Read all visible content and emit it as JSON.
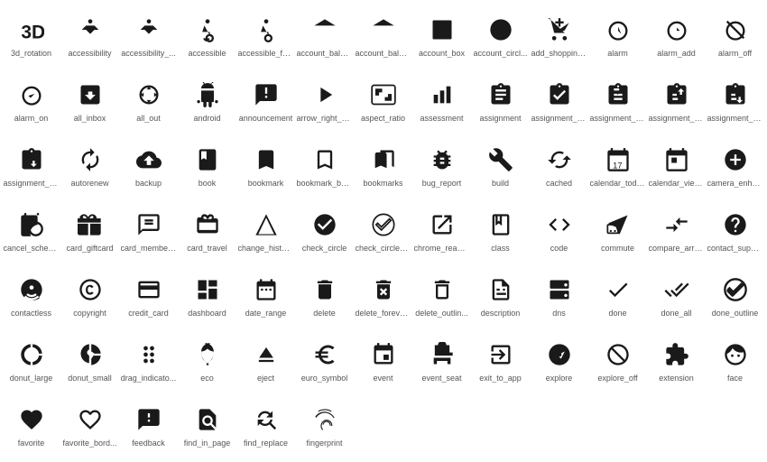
{
  "icons": [
    {
      "symbol": "3d_rotation",
      "label": "3d_rotation",
      "unicode": "⟳",
      "svg": "3d"
    },
    {
      "symbol": "accessibility",
      "label": "accessibility",
      "unicode": "♿",
      "svg": "person_arms"
    },
    {
      "symbol": "accessibility_",
      "label": "accessibility_...",
      "unicode": "♿",
      "svg": "person_arms2"
    },
    {
      "symbol": "accessible",
      "label": "accessible",
      "unicode": "♿",
      "svg": "wheelchair"
    },
    {
      "symbol": "accessible_fo",
      "label": "accessible_fo...",
      "unicode": "♿",
      "svg": "wheelchair2"
    },
    {
      "symbol": "account_balan",
      "label": "account_balan...",
      "unicode": "🏛",
      "svg": "bank"
    },
    {
      "symbol": "account_balan_",
      "label": "account_balan...",
      "unicode": "🏛",
      "svg": "bank2"
    },
    {
      "symbol": "account_box",
      "label": "account_box",
      "unicode": "👤",
      "svg": "account_box"
    },
    {
      "symbol": "account_circl",
      "label": "account_circl...",
      "unicode": "👤",
      "svg": "account_circle"
    },
    {
      "symbol": "add_shopping",
      "label": "add_shopping_...",
      "unicode": "🛒",
      "svg": "cart_add"
    },
    {
      "symbol": "alarm",
      "label": "alarm",
      "unicode": "⏰",
      "svg": "alarm"
    },
    {
      "symbol": "alarm_add",
      "label": "alarm_add",
      "unicode": "⏰",
      "svg": "alarm_add"
    },
    {
      "symbol": "alarm_off",
      "label": "alarm_off",
      "unicode": "⏰",
      "svg": "alarm_off"
    },
    {
      "symbol": "alarm_on",
      "label": "alarm_on",
      "unicode": "⏰",
      "svg": "alarm_on"
    },
    {
      "symbol": "all_inbox",
      "label": "all_inbox",
      "unicode": "📥",
      "svg": "all_inbox"
    },
    {
      "symbol": "all_out",
      "label": "all_out",
      "unicode": "◎",
      "svg": "all_out"
    },
    {
      "symbol": "android",
      "label": "android",
      "unicode": "🤖",
      "svg": "android"
    },
    {
      "symbol": "announcement",
      "label": "announcement",
      "unicode": "📢",
      "svg": "announcement"
    },
    {
      "symbol": "arrow_right_a",
      "label": "arrow_right_a...",
      "unicode": "→",
      "svg": "arrow_right"
    },
    {
      "symbol": "aspect_ratio",
      "label": "aspect_ratio",
      "unicode": "⬜",
      "svg": "aspect_ratio"
    },
    {
      "symbol": "assessment",
      "label": "assessment",
      "unicode": "📊",
      "svg": "bar_chart"
    },
    {
      "symbol": "assignment",
      "label": "assignment",
      "unicode": "📋",
      "svg": "assignment"
    },
    {
      "symbol": "assignment_in",
      "label": "assignment_in...",
      "unicode": "📋",
      "svg": "assignment_in"
    },
    {
      "symbol": "assignment_la",
      "label": "assignment_la...",
      "unicode": "📋",
      "svg": "assignment_la"
    },
    {
      "symbol": "assignment_re",
      "label": "assignment_re...",
      "unicode": "📋",
      "svg": "assignment_re"
    },
    {
      "symbol": "assignment_re_",
      "label": "assignment_re...",
      "unicode": "📋",
      "svg": "assignment_re2"
    },
    {
      "symbol": "assignment_tu",
      "label": "assignment_tu...",
      "unicode": "📋",
      "svg": "assignment_tu"
    },
    {
      "symbol": "autorenew",
      "label": "autorenew",
      "unicode": "🔄",
      "svg": "autorenew"
    },
    {
      "symbol": "backup",
      "label": "backup",
      "unicode": "☁",
      "svg": "backup"
    },
    {
      "symbol": "book",
      "label": "book",
      "unicode": "📖",
      "svg": "book"
    },
    {
      "symbol": "bookmark",
      "label": "bookmark",
      "unicode": "🔖",
      "svg": "bookmark"
    },
    {
      "symbol": "bookmark_bord",
      "label": "bookmark_bord...",
      "unicode": "🔖",
      "svg": "bookmark_border"
    },
    {
      "symbol": "bookmarks",
      "label": "bookmarks",
      "unicode": "🔖",
      "svg": "bookmarks"
    },
    {
      "symbol": "bug_report",
      "label": "bug_report",
      "unicode": "🐛",
      "svg": "bug_report"
    },
    {
      "symbol": "build",
      "label": "build",
      "unicode": "🔧",
      "svg": "build"
    },
    {
      "symbol": "cached",
      "label": "cached",
      "unicode": "🔄",
      "svg": "cached"
    },
    {
      "symbol": "calendar_toda",
      "label": "calendar_toda...",
      "unicode": "📅",
      "svg": "calendar"
    },
    {
      "symbol": "calendar_view",
      "label": "calendar_view...",
      "unicode": "📅",
      "svg": "calendar2"
    },
    {
      "symbol": "camera_enhanc",
      "label": "camera_enhanc...",
      "unicode": "📷",
      "svg": "camera"
    },
    {
      "symbol": "cancel_schedu",
      "label": "cancel_schedu...",
      "unicode": "✖",
      "svg": "cancel_sched"
    },
    {
      "symbol": "card_giftcard",
      "label": "card_giftcard",
      "unicode": "🎁",
      "svg": "gift_card"
    },
    {
      "symbol": "card_membersh",
      "label": "card_membersh...",
      "unicode": "💳",
      "svg": "membership"
    },
    {
      "symbol": "card_travel",
      "label": "card_travel",
      "unicode": "💳",
      "svg": "card_travel"
    },
    {
      "symbol": "change_histor",
      "label": "change_histor...",
      "unicode": "△",
      "svg": "change_history"
    },
    {
      "symbol": "check_circle",
      "label": "check_circle",
      "unicode": "✅",
      "svg": "check_circle"
    },
    {
      "symbol": "check_circle_",
      "label": "check_circle_...",
      "unicode": "✅",
      "svg": "check_circle2"
    },
    {
      "symbol": "chrome_reader",
      "label": "chrome_reader...",
      "unicode": "📄",
      "svg": "chrome_reader"
    },
    {
      "symbol": "class",
      "label": "class",
      "unicode": "🔖",
      "svg": "class"
    },
    {
      "symbol": "code",
      "label": "code",
      "unicode": "<>",
      "svg": "code"
    },
    {
      "symbol": "commute",
      "label": "commute",
      "unicode": "🚌",
      "svg": "commute"
    },
    {
      "symbol": "compare_arrow",
      "label": "compare_arrow...",
      "unicode": "⇄",
      "svg": "compare_arrows"
    },
    {
      "symbol": "contact_suppo",
      "label": "contact_suppo...",
      "unicode": "❓",
      "svg": "contact_support"
    },
    {
      "symbol": "contactless",
      "label": "contactless",
      "unicode": "📶",
      "svg": "contactless"
    },
    {
      "symbol": "copyright",
      "label": "copyright",
      "unicode": "©",
      "svg": "copyright"
    },
    {
      "symbol": "credit_card",
      "label": "credit_card",
      "unicode": "💳",
      "svg": "credit_card"
    },
    {
      "symbol": "dashboard",
      "label": "dashboard",
      "unicode": "⊞",
      "svg": "dashboard"
    },
    {
      "symbol": "date_range",
      "label": "date_range",
      "unicode": "📅",
      "svg": "date_range"
    },
    {
      "symbol": "delete",
      "label": "delete",
      "unicode": "🗑",
      "svg": "delete"
    },
    {
      "symbol": "delete_foreve",
      "label": "delete_foreve...",
      "unicode": "🗑",
      "svg": "delete_forever"
    },
    {
      "symbol": "delete_outlin",
      "label": "delete_outlin...",
      "unicode": "🗑",
      "svg": "delete_outline"
    },
    {
      "symbol": "description",
      "label": "description",
      "unicode": "📄",
      "svg": "description"
    },
    {
      "symbol": "dns",
      "label": "dns",
      "unicode": "⚙",
      "svg": "dns"
    },
    {
      "symbol": "done",
      "label": "done",
      "unicode": "✓",
      "svg": "done"
    },
    {
      "symbol": "done_all",
      "label": "done_all",
      "unicode": "✓✓",
      "svg": "done_all"
    },
    {
      "symbol": "done_outline",
      "label": "done_outline",
      "unicode": "✓",
      "svg": "done_outline"
    },
    {
      "symbol": "donut_large",
      "label": "donut_large",
      "unicode": "◎",
      "svg": "donut_large"
    },
    {
      "symbol": "donut_small",
      "label": "donut_small",
      "unicode": "◎",
      "svg": "donut_small"
    },
    {
      "symbol": "drag_indicato",
      "label": "drag_indicato...",
      "unicode": "⠿",
      "svg": "drag_indicator"
    },
    {
      "symbol": "eco",
      "label": "eco",
      "unicode": "🌿",
      "svg": "eco"
    },
    {
      "symbol": "eject",
      "label": "eject",
      "unicode": "⏏",
      "svg": "eject"
    },
    {
      "symbol": "euro_symbol",
      "label": "euro_symbol",
      "unicode": "€",
      "svg": "euro"
    },
    {
      "symbol": "event",
      "label": "event",
      "unicode": "📅",
      "svg": "event"
    },
    {
      "symbol": "event_seat",
      "label": "event_seat",
      "unicode": "💺",
      "svg": "event_seat"
    },
    {
      "symbol": "exit_to_app",
      "label": "exit_to_app",
      "unicode": "→",
      "svg": "exit_to_app"
    },
    {
      "symbol": "explore",
      "label": "explore",
      "unicode": "🧭",
      "svg": "explore"
    },
    {
      "symbol": "explore_off",
      "label": "explore_off",
      "unicode": "🧭",
      "svg": "explore_off"
    },
    {
      "symbol": "extension",
      "label": "extension",
      "unicode": "🧩",
      "svg": "extension"
    },
    {
      "symbol": "face",
      "label": "face",
      "unicode": "😊",
      "svg": "face"
    },
    {
      "symbol": "favorite",
      "label": "favorite",
      "unicode": "♥",
      "svg": "favorite"
    },
    {
      "symbol": "favorite_bord",
      "label": "favorite_bord...",
      "unicode": "♡",
      "svg": "favorite_border"
    },
    {
      "symbol": "feedback",
      "label": "feedback",
      "unicode": "❗",
      "svg": "feedback"
    },
    {
      "symbol": "find_in_page",
      "label": "find_in_page",
      "unicode": "🔍",
      "svg": "find_in_page"
    },
    {
      "symbol": "find_replace",
      "label": "find_replace",
      "unicode": "🔄",
      "svg": "find_replace"
    },
    {
      "symbol": "fingerprint",
      "label": "fingerprint",
      "unicode": "👆",
      "svg": "fingerprint"
    }
  ]
}
